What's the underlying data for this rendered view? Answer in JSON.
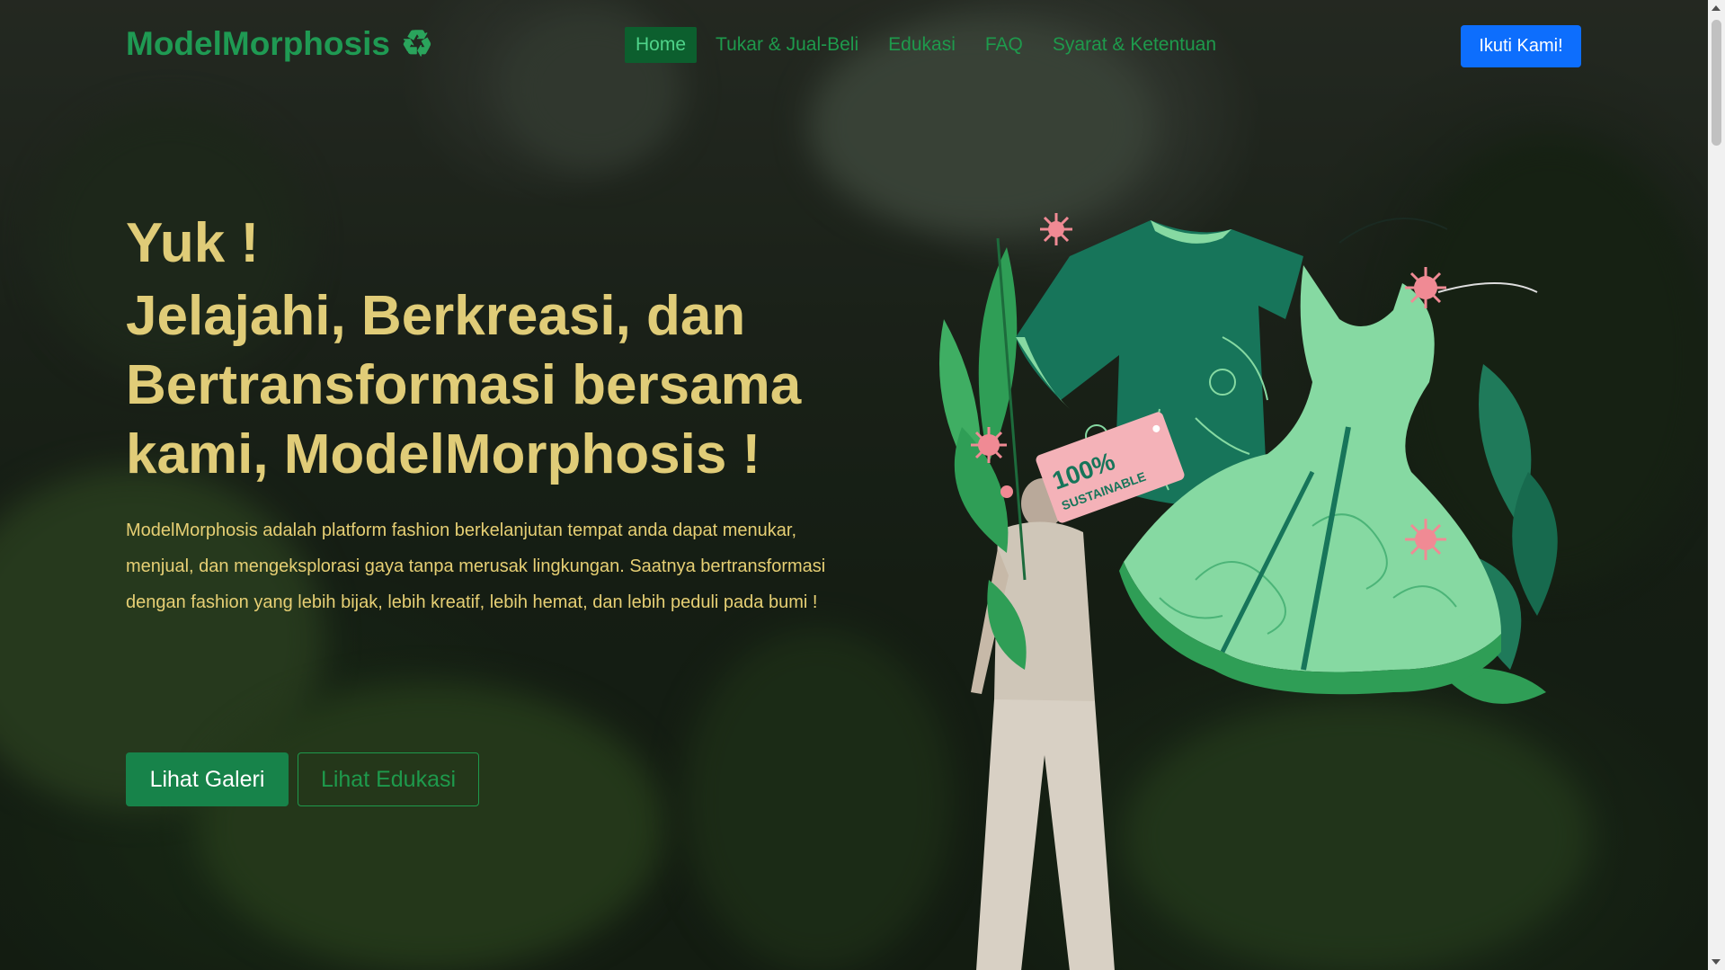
{
  "brand": {
    "name": "ModelMorphosis",
    "icon": "recycle-icon"
  },
  "nav": {
    "items": [
      {
        "label": "Home",
        "active": true
      },
      {
        "label": "Tukar & Jual-Beli",
        "active": false
      },
      {
        "label": "Edukasi",
        "active": false
      },
      {
        "label": "FAQ",
        "active": false
      },
      {
        "label": "Syarat & Ketentuan",
        "active": false
      }
    ],
    "cta": "Ikuti Kami!"
  },
  "hero": {
    "lead": "Yuk !",
    "headline": "Jelajahi, Berkreasi, dan Bertransformasi bersama kami, ModelMorphosis !",
    "description": "ModelMorphosis adalah platform fashion berkelanjutan tempat anda dapat menukar, menjual, dan mengeksplorasi gaya tanpa merusak lingkungan. Saatnya bertransformasi dengan fashion yang lebih bijak, lebih kreatif, lebih hemat, dan lebih peduli pada bumi !",
    "primary_button": "Lihat Galeri",
    "secondary_button": "Lihat Edukasi"
  },
  "illustration": {
    "tag_line1": "100%",
    "tag_line2": "SUSTAINABLE"
  },
  "colors": {
    "brand_green": "#1f9a53",
    "headline_gold": "#e0cc78",
    "cta_blue": "#0d6efd",
    "shirt_dark": "#17755a",
    "dress_light": "#86d9a2",
    "tag_pink": "#f4b2b8"
  }
}
